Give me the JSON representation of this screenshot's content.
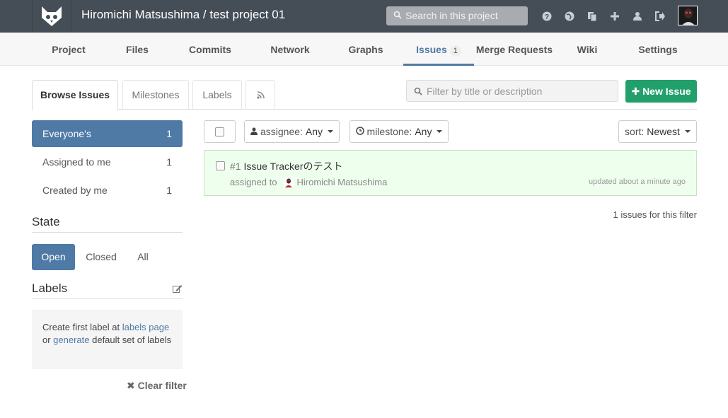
{
  "header": {
    "title": "Hiromichi Matsushima / test project 01",
    "search_placeholder": "Search in this project",
    "icons": [
      "help-icon",
      "globe-icon",
      "copy-icon",
      "plus-icon",
      "user-icon",
      "signout-icon"
    ]
  },
  "nav": {
    "tabs": [
      {
        "label": "Project"
      },
      {
        "label": "Files"
      },
      {
        "label": "Commits"
      },
      {
        "label": "Network"
      },
      {
        "label": "Graphs"
      },
      {
        "label": "Issues",
        "badge": "1",
        "active": true
      },
      {
        "label": "Merge Requests"
      },
      {
        "label": "Wiki"
      },
      {
        "label": "Settings"
      }
    ]
  },
  "subtabs": {
    "browse": "Browse Issues",
    "milestones": "Milestones",
    "labels": "Labels"
  },
  "filter_placeholder": "Filter by title or description",
  "new_issue_label": "New Issue",
  "sidebar": {
    "scope": [
      {
        "label": "Everyone's",
        "count": "1",
        "active": true
      },
      {
        "label": "Assigned to me",
        "count": "1"
      },
      {
        "label": "Created by me",
        "count": "1"
      }
    ],
    "state_title": "State",
    "states": [
      "Open",
      "Closed",
      "All"
    ],
    "labels_title": "Labels",
    "labels_text_1": "Create first label at ",
    "labels_link_1": "labels page",
    "labels_text_2": "or ",
    "labels_link_2": "generate",
    "labels_text_3": " default set of labels",
    "clear_filter": "Clear filter"
  },
  "filters": {
    "assignee_label": "assignee:",
    "assignee_value": "Any",
    "milestone_label": "milestone:",
    "milestone_value": "Any",
    "sort_label": "sort:",
    "sort_value": "Newest"
  },
  "issues": [
    {
      "number": "#1",
      "title": "Issue Trackerのテスト",
      "assigned_prefix": "assigned to",
      "assignee": "Hiromichi Matsushima",
      "updated": "updated about a minute ago"
    }
  ],
  "issues_count_text": "1 issues for this filter",
  "colors": {
    "header_bg": "#454d57",
    "accent": "#4f7aa5",
    "success": "#22a06b",
    "issue_bg": "#efffee"
  }
}
